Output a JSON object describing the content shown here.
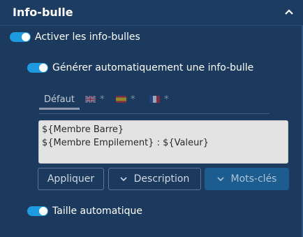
{
  "panel": {
    "title": "Info-bulle",
    "collapse_icon": "chevron-up-icon"
  },
  "toggles": {
    "enable_tooltips": {
      "label": "Activer les info-bulles",
      "on": true
    },
    "auto_generate": {
      "label": "Générer automatiquement une info-bulle",
      "on": true
    },
    "auto_size": {
      "label": "Taille automatique",
      "on": true
    }
  },
  "tabs": {
    "default_label": "Défaut",
    "languages": [
      {
        "flag": "uk-flag-icon",
        "marker": "*"
      },
      {
        "flag": "spain-flag-icon",
        "marker": "*"
      },
      {
        "flag": "france-flag-icon",
        "marker": "*"
      }
    ]
  },
  "editor": {
    "line1": "${Membre Barre}",
    "line2": "${Membre Empilement} : ${Valeur}"
  },
  "buttons": {
    "apply": "Appliquer",
    "description": "Description",
    "keywords": "Mots-clés"
  },
  "colors": {
    "background": "#1b3a5e",
    "toggle_on": "#1e9be0",
    "primary_button": "#1c5c8e"
  }
}
